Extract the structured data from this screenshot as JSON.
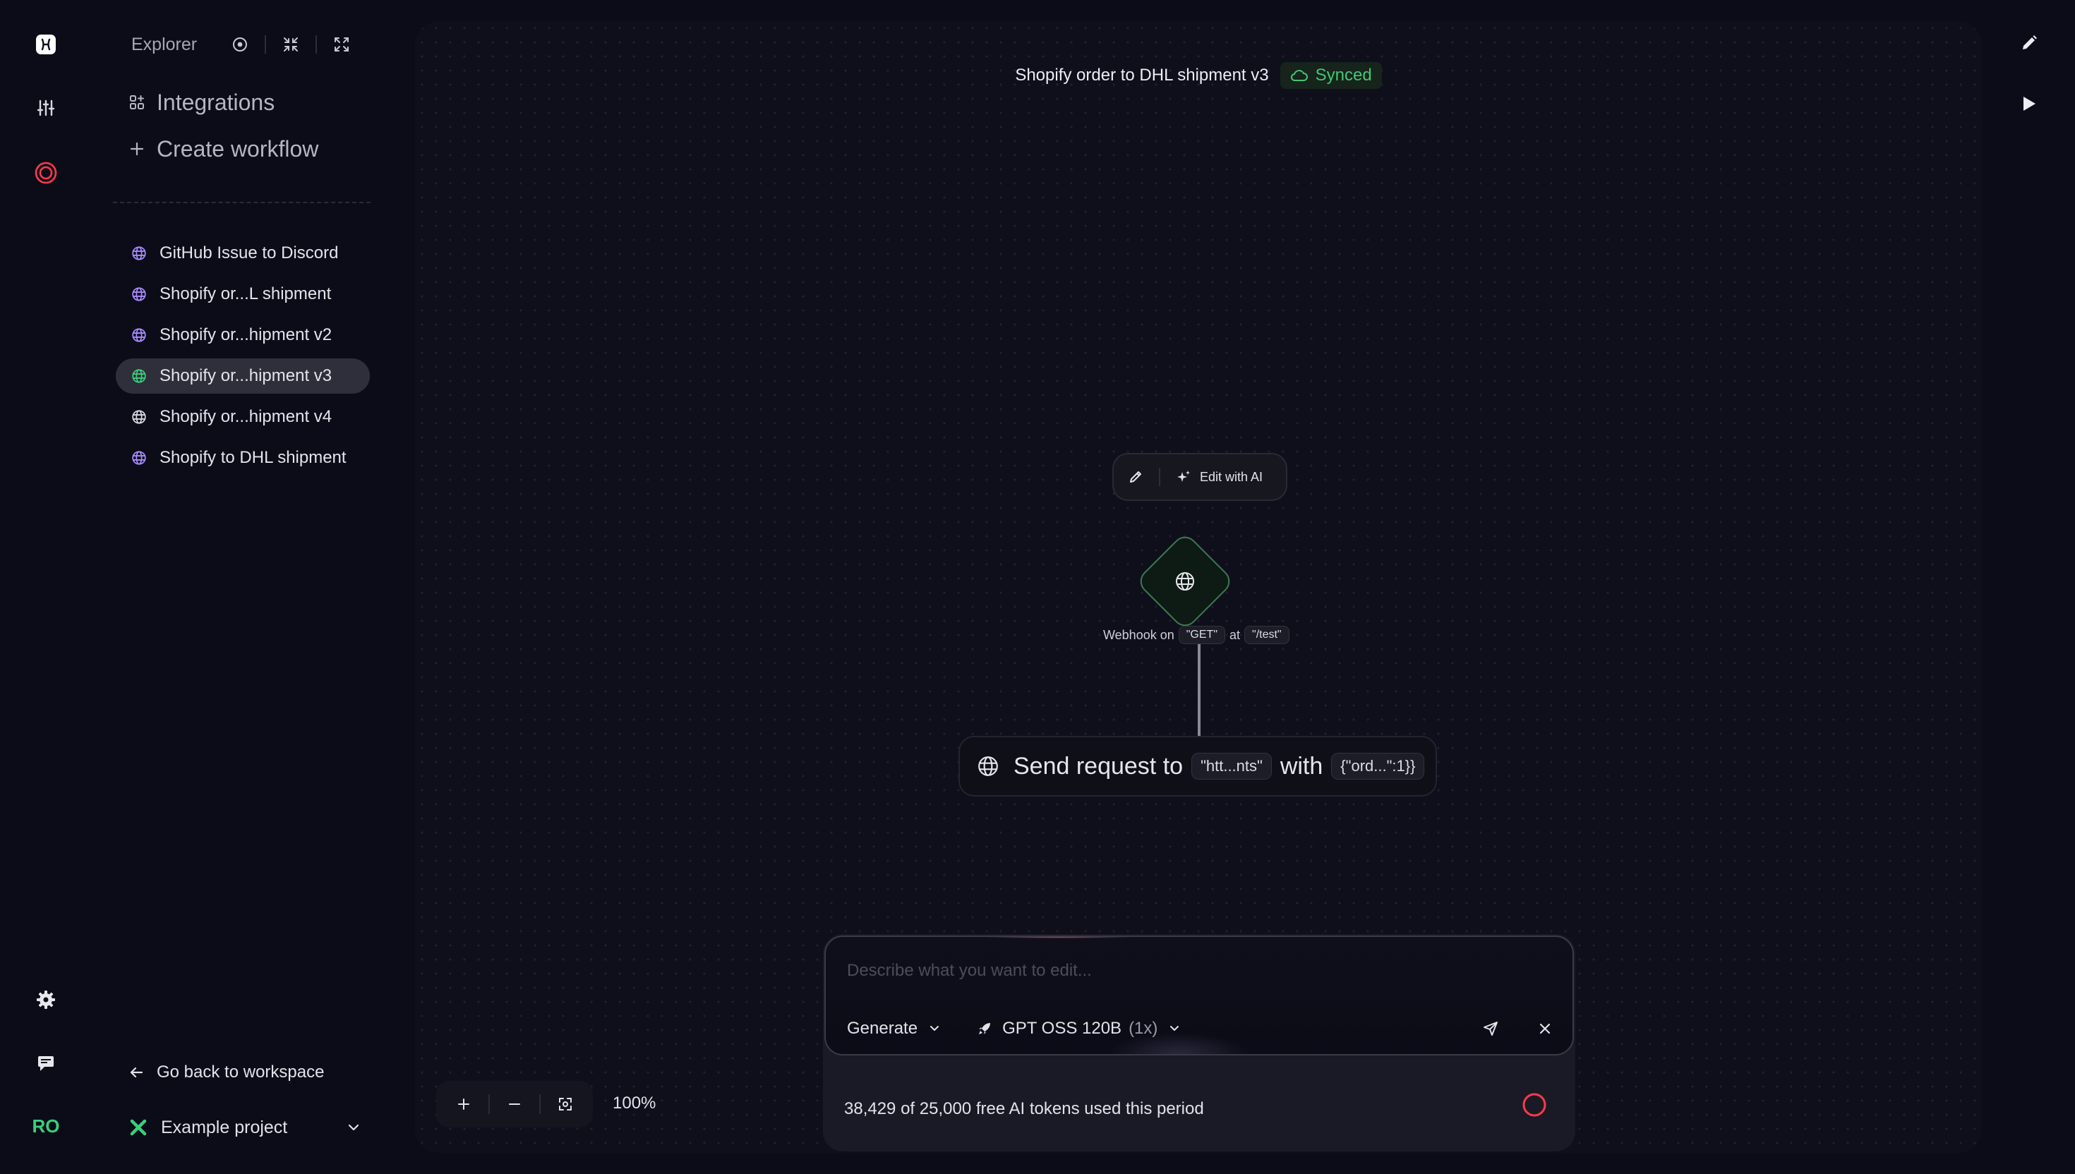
{
  "app": {
    "user_initials": "RO",
    "accent_color": "#38d07a",
    "danger_color": "#ff3a4a"
  },
  "sidebar": {
    "explorer_title": "Explorer",
    "integrations_label": "Integrations",
    "create_workflow_label": "Create workflow",
    "workflows": [
      {
        "label": "GitHub Issue to Discord",
        "active": false,
        "icon": "globe-icon"
      },
      {
        "label": "Shopify or...L shipment",
        "active": false,
        "icon": "globe-icon"
      },
      {
        "label": "Shopify or...hipment v2",
        "active": false,
        "icon": "globe-icon"
      },
      {
        "label": "Shopify or...hipment v3",
        "active": true,
        "icon": "globe-icon"
      },
      {
        "label": "Shopify or...hipment v4",
        "active": false,
        "icon": "globe-icon"
      },
      {
        "label": "Shopify to DHL shipment",
        "active": false,
        "icon": "globe-icon"
      }
    ],
    "go_back_label": "Go back to workspace",
    "project_name": "Example project"
  },
  "canvas": {
    "workflow_title": "Shopify order to DHL shipment v3",
    "sync_status": "Synced",
    "node_toolbar": {
      "edit_with_ai_label": "Edit with AI"
    },
    "trigger": {
      "prefix": "Webhook on",
      "method": "\"GET\"",
      "connector": "at",
      "path": "\"/test\""
    },
    "action": {
      "prefix": "Send request to",
      "url": "\"htt...nts\"",
      "connector": "with",
      "body": "{\"ord...\":1}}"
    },
    "zoom_level": "100%"
  },
  "ai_panel": {
    "placeholder": "Describe what you want to edit...",
    "mode_label": "Generate",
    "model_name": "GPT OSS 120B",
    "model_multiplier": "(1x)",
    "token_usage_text": "38,429 of 25,000 free AI tokens used this period"
  }
}
